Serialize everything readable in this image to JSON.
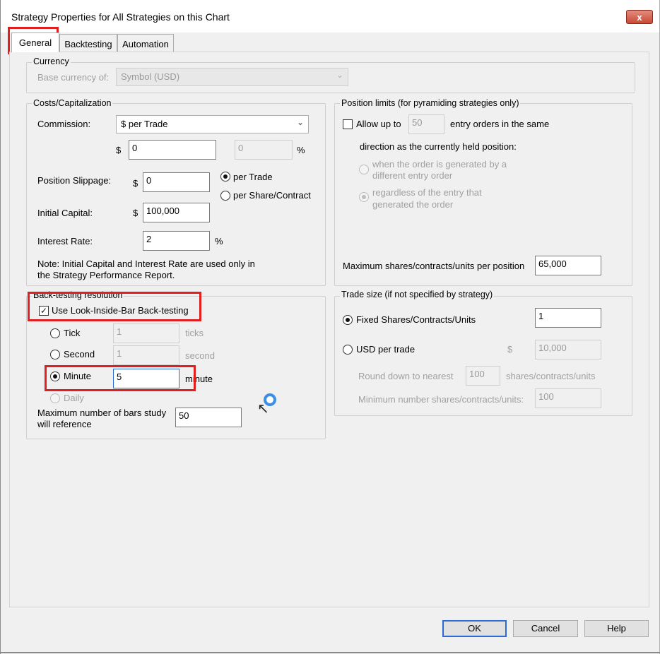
{
  "window": {
    "title": "Strategy Properties for All Strategies on this Chart",
    "close_glyph": "x"
  },
  "tabs": [
    {
      "label": "General",
      "active": true
    },
    {
      "label": "Backtesting",
      "active": false
    },
    {
      "label": "Automation",
      "active": false
    }
  ],
  "currency": {
    "title": "Currency",
    "base_label": "Base currency of:",
    "base_value": "Symbol (USD)"
  },
  "costs": {
    "title": "Costs/Capitalization",
    "commission_label": "Commission:",
    "commission_type": "$ per Trade",
    "dollar_symbol": "$",
    "commission_value": "0",
    "percent_value": "0",
    "percent_symbol": "%",
    "slippage_label": "Position Slippage:",
    "slippage_value": "0",
    "per_trade_label": "per Trade",
    "per_share_label": "per Share/Contract",
    "initial_capital_label": "Initial Capital:",
    "initial_capital_value": "100,000",
    "interest_label": "Interest Rate:",
    "interest_value": "2",
    "note_line1": "Note: Initial Capital and Interest Rate are used only in",
    "note_line2": "the Strategy Performance Report."
  },
  "backtest_resolution": {
    "title": "Back-testing resolution",
    "lib_label": "Use Look-Inside-Bar Back-testing",
    "lib_checked": true,
    "tick_label": "Tick",
    "tick_value": "1",
    "tick_unit": "ticks",
    "second_label": "Second",
    "second_value": "1",
    "second_unit": "second",
    "minute_label": "Minute",
    "minute_value": "5",
    "minute_unit": "minute",
    "daily_label": "Daily",
    "max_bars_line1": "Maximum number of bars study",
    "max_bars_line2": "will reference",
    "max_bars_value": "50"
  },
  "position_limits": {
    "title": "Position limits (for pyramiding strategies only)",
    "allow_label": "Allow up to",
    "allow_value": "50",
    "entry_text": "entry orders in the same",
    "direction_text": "direction as the currently held position:",
    "option1_line1": "when the order is generated by a",
    "option1_line2": "different entry order",
    "option2_line1": "regardless of the entry that",
    "option2_line2": "generated the order",
    "max_shares_label": "Maximum shares/contracts/units per position",
    "max_shares_value": "65,000"
  },
  "trade_size": {
    "title": "Trade size (if not specified by strategy)",
    "fixed_label": "Fixed Shares/Contracts/Units",
    "fixed_value": "1",
    "usd_label": "USD per trade",
    "usd_symbol": "$",
    "usd_value": "10,000",
    "round_label": "Round down to nearest",
    "round_value": "100",
    "round_unit": "shares/contracts/units",
    "min_label": "Minimum number shares/contracts/units:",
    "min_value": "100"
  },
  "buttons": {
    "ok": "OK",
    "cancel": "Cancel",
    "help": "Help"
  }
}
